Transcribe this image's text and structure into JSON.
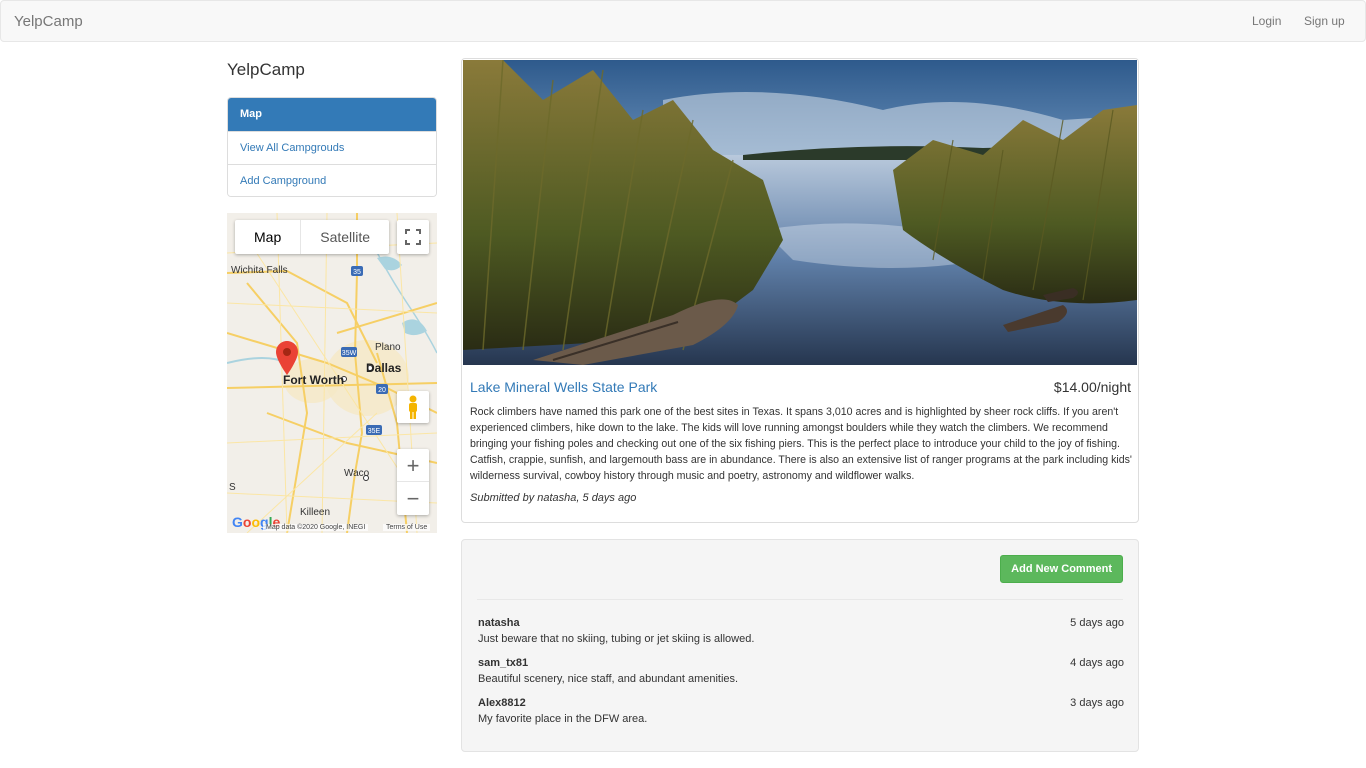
{
  "navbar": {
    "brand": "YelpCamp",
    "login": "Login",
    "signup": "Sign up"
  },
  "sidebar": {
    "title": "YelpCamp",
    "items": [
      {
        "label": "Map",
        "active": true
      },
      {
        "label": "View All Campgrouds",
        "active": false
      },
      {
        "label": "Add Campground",
        "active": false
      }
    ]
  },
  "map": {
    "type_map": "Map",
    "type_satellite": "Satellite",
    "cities": {
      "wichita_falls": "Wichita Falls",
      "fort_worth": "Fort Worth",
      "dallas": "Dallas",
      "plano": "Plano",
      "waco": "Waco",
      "killeen": "Killeen",
      "s": "S"
    },
    "shields": [
      "35",
      "35W",
      "35E",
      "20"
    ],
    "logo": "Google",
    "attribution": "Map data ©2020 Google, INEGI",
    "terms": "Terms of Use"
  },
  "campground": {
    "name": "Lake Mineral Wells State Park",
    "price": "$14.00/night",
    "description": "Rock climbers have named this park one of the best sites in Texas. It spans 3,010 acres and is highlighted by sheer rock cliffs. If you aren't experienced climbers, hike down to the lake. The kids will love running amongst boulders while they watch the climbers. We recommend bringing your fishing poles and checking out one of the six fishing piers. This is the perfect place to introduce your child to the joy of fishing. Catfish, crappie, sunfish, and largemouth bass are in abundance. There is also an extensive list of ranger programs at the park including kids' wilderness survival, cowboy history through music and poetry, astronomy and wildflower walks.",
    "submitted": "Submitted by natasha, 5 days ago"
  },
  "comments_section": {
    "add_button": "Add New Comment",
    "comments": [
      {
        "author": "natasha",
        "time": "5 days ago",
        "text": "Just beware that no skiing, tubing or jet skiing is allowed."
      },
      {
        "author": "sam_tx81",
        "time": "4 days ago",
        "text": "Beautiful scenery, nice staff, and abundant amenities."
      },
      {
        "author": "Alex8812",
        "time": "3 days ago",
        "text": "My favorite place in the DFW area."
      }
    ]
  },
  "colors": {
    "link": "#337ab7",
    "success": "#5cb85c",
    "marker": "#ea4335"
  }
}
